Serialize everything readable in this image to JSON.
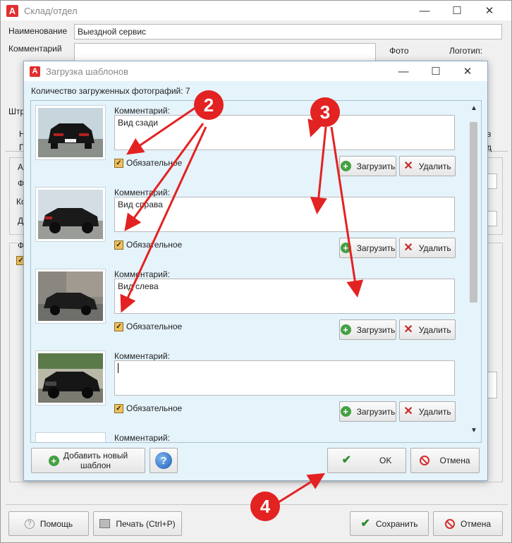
{
  "main_window": {
    "title": "Склад/отдел",
    "name_label": "Наименование",
    "name_value": "Выездной сервис",
    "comment_label": "Комментарий",
    "photo_label": "Фото",
    "logo_label": "Логотип:",
    "shtr_label": "Штр",
    "bg_fragments": [
      "Н",
      "П",
      "А",
      "Ф",
      "Ко",
      "Д",
      "Ф",
      "в",
      "д"
    ],
    "help_label": "Помощь",
    "print_label": "Печать (Ctrl+P)",
    "save_label": "Сохранить",
    "cancel_label": "Отмена"
  },
  "dialog": {
    "title": "Загрузка шаблонов",
    "count_label": "Количество загруженных фотографий: 7",
    "templates": [
      {
        "comment_label": "Комментарий:",
        "comment": "Вид сзади",
        "required_label": "Обязательное",
        "required": true,
        "upload_label": "Загрузить",
        "delete_label": "Удалить"
      },
      {
        "comment_label": "Комментарий:",
        "comment": "Вид справа",
        "required_label": "Обязательное",
        "required": true,
        "upload_label": "Загрузить",
        "delete_label": "Удалить"
      },
      {
        "comment_label": "Комментарий:",
        "comment": "Вид слева",
        "required_label": "Обязательное",
        "required": true,
        "upload_label": "Загрузить",
        "delete_label": "Удалить"
      },
      {
        "comment_label": "Комментарий:",
        "comment": "",
        "required_label": "Обязательное",
        "required": true,
        "upload_label": "Загрузить",
        "delete_label": "Удалить"
      },
      {
        "comment_label": "Комментарий:"
      }
    ],
    "add_label_1": "Добавить новый",
    "add_label_2": "шаблон",
    "help_icon": "?",
    "ok_label": "OK",
    "cancel_label": "Отмена"
  },
  "annotations": {
    "badge_2": "2",
    "badge_3": "3",
    "badge_4": "4"
  },
  "colors": {
    "dialog_bg": "#e5f3fb",
    "annotation_red": "#e32222",
    "checkbox_fill": "#f0c05a"
  }
}
